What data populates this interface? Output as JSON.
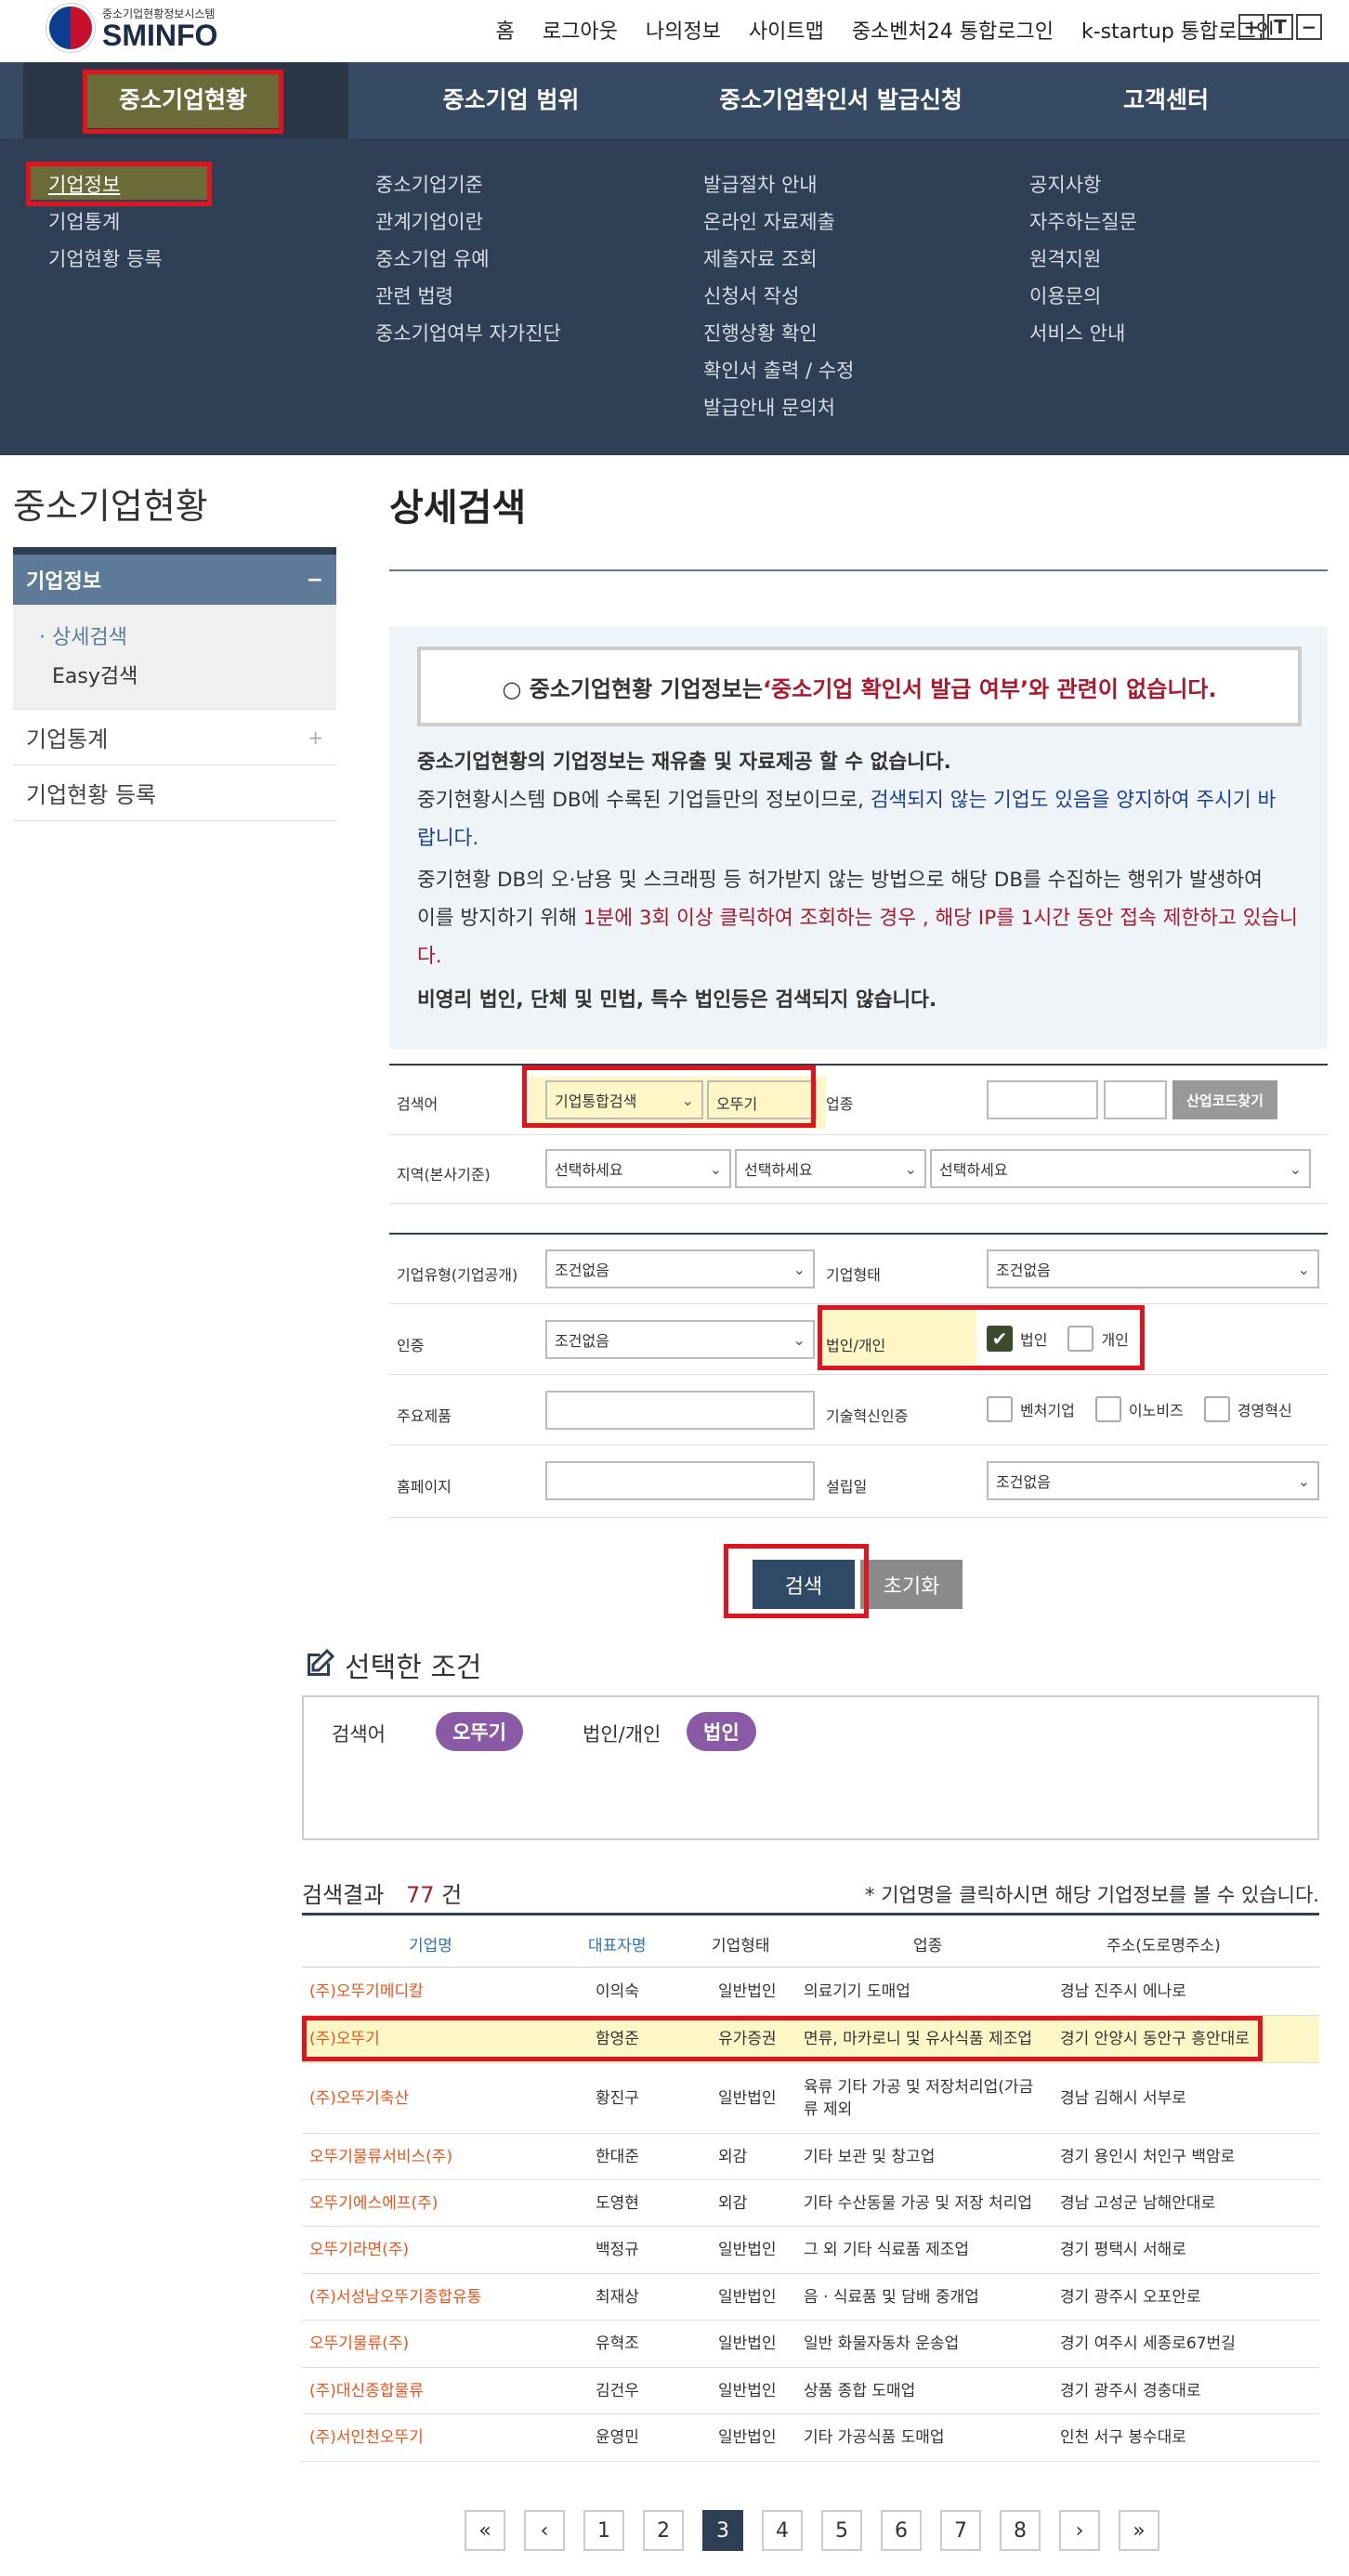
{
  "header": {
    "brand_sub": "중소기업현황정보시스템",
    "brand": "SMINFO",
    "links": [
      "홈",
      "로그아웃",
      "나의정보",
      "사이트맵",
      "중소벤처24 통합로그인",
      "k-startup 통합로그인"
    ],
    "font_buttons": [
      "+",
      "T",
      "−"
    ]
  },
  "gnb": [
    "중소기업현황",
    "중소기업 범위",
    "중소기업확인서 발급신청",
    "고객센터"
  ],
  "mega": {
    "col1": [
      "기업정보",
      "기업통계",
      "기업현황 등록"
    ],
    "col2": [
      "중소기업기준",
      "관계기업이란",
      "중소기업 유예",
      "관련 법령",
      "중소기업여부 자가진단"
    ],
    "col3": [
      "발급절차 안내",
      "온라인 자료제출",
      "제출자료 조회",
      "신청서 작성",
      "진행상황 확인",
      "확인서 출력 / 수정",
      "발급안내 문의처"
    ],
    "col4": [
      "공지사항",
      "자주하는질문",
      "원격지원",
      "이용문의",
      "서비스 안내"
    ]
  },
  "sidebar": {
    "title": "중소기업현황",
    "section": "기업정보",
    "section_toggle": "−",
    "sub": [
      "상세검색",
      "Easy검색"
    ],
    "items": [
      {
        "label": "기업통계",
        "toggle": "+"
      },
      {
        "label": "기업현황 등록"
      }
    ]
  },
  "page_title": "상세검색",
  "notice": {
    "box_prefix": "○ 중소기업현황 기업정보는 ",
    "box_quote": "‘중소기업 확인서 발급 여부’",
    "box_suffix": "와 관련이 없습니다.",
    "p1": "중소기업현황의 기업정보는 재유출 및 자료제공 할 수 없습니다.",
    "p2a": "중기현황시스템 DB에 수록된 기업들만의 정보이므로, ",
    "p2b": "검색되지 않는 기업도 있음을 양지하여 주시기 바",
    "p2c": "랍니다.",
    "p3a": "중기현황 DB의 오·남용 및 스크래핑 등 허가받지 않는 방법으로 해당 DB를 수집하는 행위가 발생하여",
    "p3b": "이를 방지하기 위해 ",
    "p3c": "1분에 3회 이상 클릭하여 조회하는 경우 , 해당 IP를 1시간 동안 접속 제한하고 있습니",
    "p3d": "다.",
    "p4": "비영리 법인, 단체 및 민법, 특수 법인등은 검색되지 않습니다."
  },
  "form": {
    "search_label": "검색어",
    "search_type": "기업통합검색",
    "search_value": "오뚜기",
    "industry_label": "업종",
    "industry_btn": "산업코드찾기",
    "region_label": "지역(본사기준)",
    "region_ph": "선택하세요",
    "type_label": "기업유형(기업공개)",
    "type_val": "조건없음",
    "form_label": "기업형태",
    "form_val": "조건없음",
    "cert_label": "인증",
    "cert_val": "조건없음",
    "corp_label": "법인/개인",
    "corp_opt1": "법인",
    "corp_opt2": "개인",
    "product_label": "주요제품",
    "tech_label": "기술혁신인증",
    "tech_opts": [
      "벤처기업",
      "이노비즈",
      "경영혁신"
    ],
    "home_label": "홈페이지",
    "estab_label": "설립일",
    "estab_val": "조건없음",
    "search_btn": "검색",
    "reset_btn": "초기화"
  },
  "selected": {
    "title": "선택한 조건",
    "k1": "검색어",
    "v1": "오뚜기",
    "k2": "법인/개인",
    "v2": "법인"
  },
  "results": {
    "label": "검색결과",
    "count": "77",
    "unit": "건",
    "note": "*  기업명을 클릭하시면 해당 기업정보를 볼 수 있습니다.",
    "headers": [
      "기업명",
      "대표자명",
      "기업형태",
      "업종",
      "주소(도로명주소)"
    ],
    "rows": [
      [
        "(주)오뚜기메디칼",
        "이의숙",
        "일반법인",
        "의료기기 도매업",
        "경남 진주시 에나로"
      ],
      [
        "(주)오뚜기",
        "함영준",
        "유가증권",
        "면류, 마카로니 및 유사식품 제조업",
        "경기 안양시 동안구 흥안대로"
      ],
      [
        "(주)오뚜기축산",
        "황진구",
        "일반법인",
        "육류 기타 가공 및 저장처리업(가금류 제외",
        "경남 김해시 서부로"
      ],
      [
        "오뚜기물류서비스(주)",
        "한대준",
        "외감",
        "기타 보관 및 창고업",
        "경기 용인시 처인구 백암로"
      ],
      [
        "오뚜기에스에프(주)",
        "도영현",
        "외감",
        "기타 수산동물 가공 및 저장 처리업",
        "경남 고성군 남해안대로"
      ],
      [
        "오뚜기라면(주)",
        "백정규",
        "일반법인",
        "그 외 기타 식료품 제조업",
        "경기 평택시 서해로"
      ],
      [
        "(주)서성남오뚜기종합유통",
        "최재상",
        "일반법인",
        "음 · 식료품 및 담배 중개업",
        "경기 광주시 오포안로"
      ],
      [
        "오뚜기물류(주)",
        "유혁조",
        "일반법인",
        "일반 화물자동차 운송업",
        "경기 여주시 세종로67번길"
      ],
      [
        "(주)대신종합물류",
        "김건우",
        "일반법인",
        "상품 종합 도매업",
        "경기 광주시 경충대로"
      ],
      [
        "(주)서인천오뚜기",
        "윤영민",
        "일반법인",
        "기타 가공식품 도매업",
        "인천 서구 봉수대로"
      ]
    ]
  },
  "pagination": [
    "«",
    "‹",
    "1",
    "2",
    "3",
    "4",
    "5",
    "6",
    "7",
    "8",
    "›",
    "»"
  ],
  "current_page": "3"
}
